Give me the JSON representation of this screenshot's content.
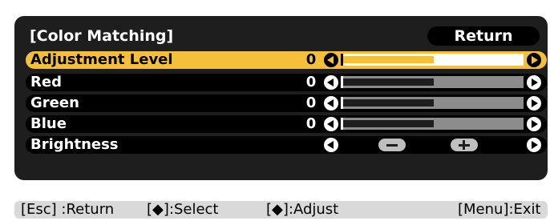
{
  "menu": {
    "title": "[Color Matching]",
    "return_label": "Return",
    "rows": [
      {
        "label": "Adjustment Level",
        "value": "0",
        "level": 0.5
      },
      {
        "label": "Red",
        "value": "0",
        "level": 0.5
      },
      {
        "label": "Green",
        "value": "0",
        "level": 0.5
      },
      {
        "label": "Blue",
        "value": "0",
        "level": 0.5
      },
      {
        "label": "Brightness",
        "value": "",
        "level": null
      }
    ]
  },
  "footer": {
    "esc": "[Esc] :Return",
    "select": "[◆]:Select",
    "adjust": "[◆]:Adjust",
    "menu": "[Menu]:Exit"
  },
  "colors": {
    "highlight": "#f5bf3c",
    "panel": "#1e1e1e",
    "footer": "#d9d9d9"
  }
}
